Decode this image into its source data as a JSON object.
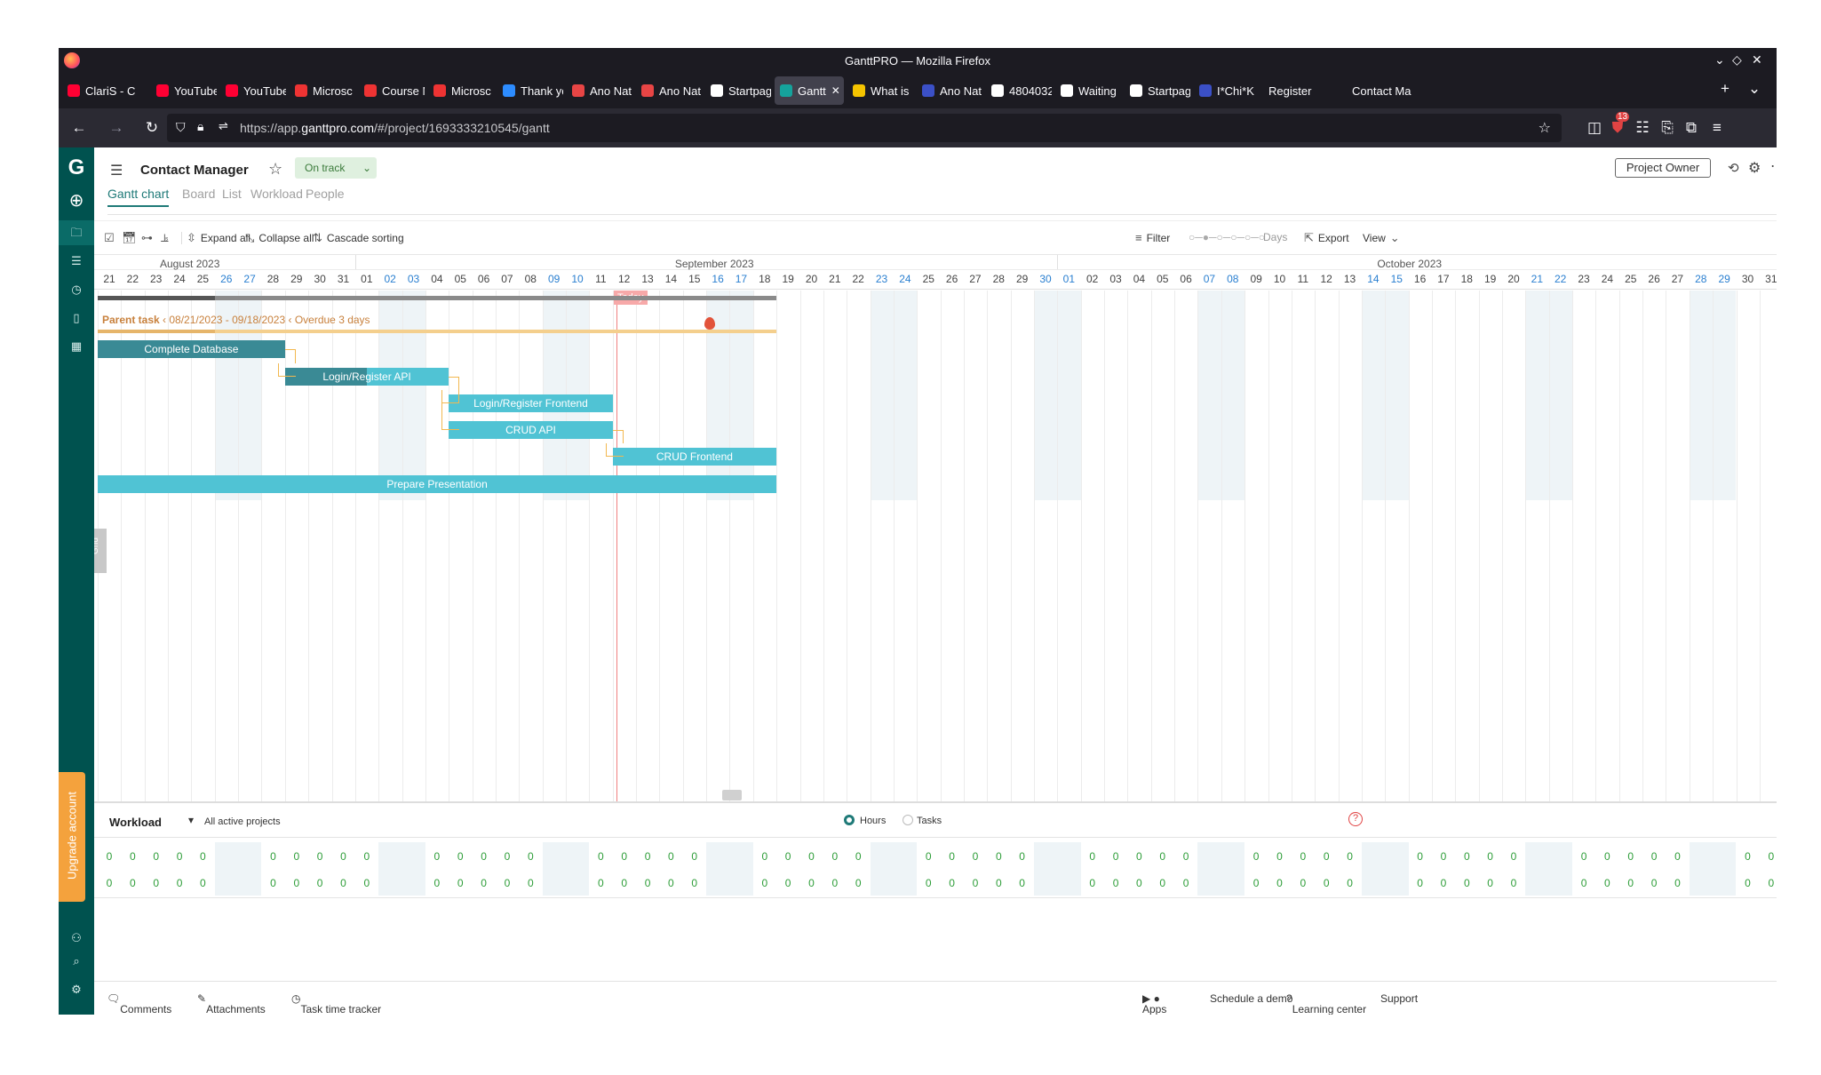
{
  "window": {
    "title": "GanttPRO — Mozilla Firefox"
  },
  "tabs": [
    {
      "label": "ClariS - C",
      "color": "#ff0033"
    },
    {
      "label": "YouTube",
      "color": "#ff0033"
    },
    {
      "label": "YouTube",
      "color": "#ff0033"
    },
    {
      "label": "Microsc",
      "color": "#e33"
    },
    {
      "label": "Course M",
      "color": "#e33"
    },
    {
      "label": "Microsc",
      "color": "#e33"
    },
    {
      "label": "Thank yc",
      "color": "#2d8cff"
    },
    {
      "label": "Ano Nat",
      "color": "#e84545"
    },
    {
      "label": "Ano Nat",
      "color": "#e84545"
    },
    {
      "label": "Startpag",
      "color": "#ffffff"
    },
    {
      "label": "Gantt",
      "color": "#15a39c",
      "active": true
    },
    {
      "label": "What is",
      "color": "#f5c400"
    },
    {
      "label": "Ano Nat",
      "color": "#3b50c7"
    },
    {
      "label": "4804032",
      "color": "#ffffff"
    },
    {
      "label": "Waiting",
      "color": "#ffffff"
    },
    {
      "label": "Startpag",
      "color": "#ffffff"
    },
    {
      "label": "I*Chi*K",
      "color": "#3b50c7"
    },
    {
      "label": "Register",
      "color": ""
    },
    {
      "label": "Contact Ma",
      "color": ""
    }
  ],
  "url": {
    "prefix": "https://app.",
    "host": "ganttpro.com",
    "path": "/#/project/1693333210545/gantt"
  },
  "browser_badge": "13",
  "project": {
    "name": "Contact Manager",
    "status": "On track",
    "owner": "Project Owner"
  },
  "views": [
    "Gantt chart",
    "Board",
    "List",
    "Workload",
    "People"
  ],
  "active_view": "Gantt chart",
  "toolbar": {
    "expand_all": "Expand all",
    "collapse_all": "Collapse all",
    "cascade_sorting": "Cascade sorting",
    "filter": "Filter",
    "zoom_unit": "Days",
    "export": "Export",
    "view": "View"
  },
  "timeline": {
    "months": [
      {
        "label": "August 2023",
        "start_index": 0
      },
      {
        "label": "September 2023",
        "start_index": 11
      },
      {
        "label": "October 2023",
        "start_index": 41
      }
    ],
    "days": [
      "21",
      "22",
      "23",
      "24",
      "25",
      "26",
      "27",
      "28",
      "29",
      "30",
      "31",
      "01",
      "02",
      "03",
      "04",
      "05",
      "06",
      "07",
      "08",
      "09",
      "10",
      "11",
      "12",
      "13",
      "14",
      "15",
      "16",
      "17",
      "18",
      "19",
      "20",
      "21",
      "22",
      "23",
      "24",
      "25",
      "26",
      "27",
      "28",
      "29",
      "30",
      "01",
      "02",
      "03",
      "04",
      "05",
      "06",
      "07",
      "08",
      "09",
      "10",
      "11",
      "12",
      "13",
      "14",
      "15",
      "16",
      "17",
      "18",
      "19",
      "20",
      "21",
      "22",
      "23",
      "24",
      "25",
      "26",
      "27",
      "28",
      "29",
      "30",
      "31"
    ],
    "weekend_indices": [
      5,
      6,
      12,
      13,
      19,
      20,
      26,
      27,
      33,
      34,
      40,
      41,
      47,
      48,
      54,
      55,
      61,
      62,
      68,
      69
    ],
    "today_index": 22,
    "today_label": "Today"
  },
  "parent_task": {
    "label": "Parent task",
    "dates": "08/21/2023 - 09/18/2023",
    "overdue": "Overdue 3 days",
    "start_index": 0,
    "end_index": 29
  },
  "tasks": [
    {
      "name": "Complete Database",
      "start_index": 0,
      "days": 8,
      "color": "#3a8a95",
      "progress": 1
    },
    {
      "name": "Login/Register API",
      "start_index": 8,
      "days": 7,
      "color": "#50c3d4",
      "progress": 0.5
    },
    {
      "name": "Login/Register Frontend",
      "start_index": 15,
      "days": 7,
      "color": "#50c3d4",
      "progress": 0
    },
    {
      "name": "CRUD API",
      "start_index": 15,
      "days": 7,
      "color": "#50c3d4",
      "progress": 0
    },
    {
      "name": "CRUD Frontend",
      "start_index": 22,
      "days": 7,
      "color": "#50c3d4",
      "progress": 0
    },
    {
      "name": "Prepare Presentation",
      "start_index": 0,
      "days": 29,
      "color": "#50c3d4",
      "progress": 0
    }
  ],
  "grid_tab": "Grid",
  "workload": {
    "title": "Workload",
    "scope": "All active projects",
    "mode_hours": "Hours",
    "mode_tasks": "Tasks",
    "value": "0"
  },
  "footer": {
    "comments": "Comments",
    "attachments": "Attachments",
    "time_tracker": "Task time tracker",
    "apps": "Apps",
    "demo": "Schedule a demo",
    "learning": "Learning center",
    "support": "Support"
  },
  "sidebar": {
    "upgrade": "Upgrade account"
  }
}
